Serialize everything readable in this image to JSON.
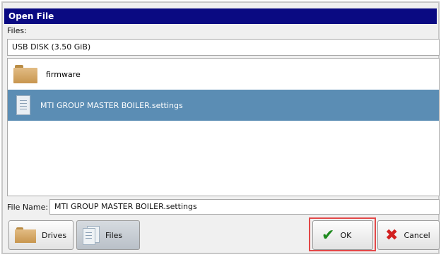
{
  "window": {
    "title": "Open File"
  },
  "files_label": "Files:",
  "drive": {
    "selected": "USB DISK (3.50 GiB)"
  },
  "file_list": [
    {
      "name": "firmware",
      "type": "folder",
      "selected": false
    },
    {
      "name": "MTI GROUP MASTER BOILER.settings",
      "type": "file",
      "selected": true
    }
  ],
  "file_name": {
    "label": "File Name:",
    "value": "MTI GROUP MASTER BOILER.settings"
  },
  "buttons": {
    "drives": "Drives",
    "files": "Files",
    "ok": "OK",
    "cancel": "Cancel"
  },
  "colors": {
    "title_bar": "#0a0a82",
    "selection": "#5b8db4",
    "ok_highlight": "#e24848"
  }
}
